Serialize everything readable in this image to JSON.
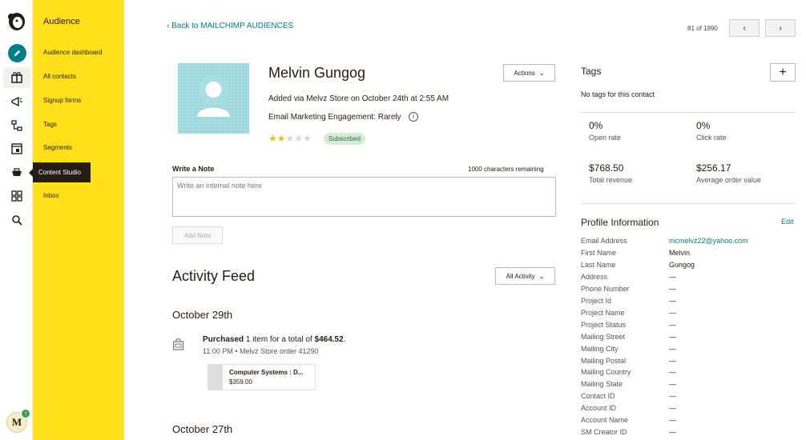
{
  "rail": {
    "avatar_letter": "M",
    "avatar_badge": "↑"
  },
  "submenu": {
    "title": "Audience",
    "items": [
      "Audience dashboard",
      "All contacts",
      "Signup forms",
      "Tags",
      "Segments",
      "Content Studio",
      "Inbox"
    ],
    "tooltip": "Content Studio"
  },
  "header": {
    "back_link": "Back to MAILCHIMP AUDIENCES",
    "pager": "81 of 1990"
  },
  "contact": {
    "name": "Melvin Gungog",
    "added": "Added via Melvz Store on October 24th at 2:55 AM",
    "engagement": "Email Marketing Engagement: Rarely",
    "rating": 2,
    "rating_max": 5,
    "status": "Subscribed",
    "actions_label": "Actions"
  },
  "note": {
    "title": "Write a Note",
    "remaining": "1000 characters remaining",
    "placeholder": "Write an internal note here",
    "button": "Add Note"
  },
  "feed": {
    "title": "Activity Feed",
    "filter": "All Activity",
    "groups": [
      {
        "date": "October 29th",
        "action": "Purchased",
        "text": " 1 item for a total of ",
        "amount": "$464.52",
        "period": ".",
        "meta": "11:00 PM • Melvz Store order 41290",
        "product_name": "Computer Systems : D...",
        "product_price": "$359.00"
      },
      {
        "date": "October 27th"
      }
    ]
  },
  "tags": {
    "title": "Tags",
    "add": "+",
    "empty": "No tags for this contact"
  },
  "stats": [
    {
      "value": "0%",
      "label": "Open rate"
    },
    {
      "value": "0%",
      "label": "Click rate"
    },
    {
      "value": "$768.50",
      "label": "Total revenue"
    },
    {
      "value": "$256.17",
      "label": "Average order value"
    }
  ],
  "profile": {
    "title": "Profile Information",
    "edit": "Edit",
    "fields": [
      {
        "label": "Email Address",
        "value": "mcmelvz22@yahoo.com"
      },
      {
        "label": "First Name",
        "value": "Melvin"
      },
      {
        "label": "Last Name",
        "value": "Gungog"
      },
      {
        "label": "Address",
        "value": "—"
      },
      {
        "label": "Phone Number",
        "value": "—"
      },
      {
        "label": "Project Id",
        "value": "—"
      },
      {
        "label": "Project Name",
        "value": "—"
      },
      {
        "label": "Project Status",
        "value": "—"
      },
      {
        "label": "Mailing Street",
        "value": "—"
      },
      {
        "label": "Mailing City",
        "value": "—"
      },
      {
        "label": "Mailing Postal",
        "value": "—"
      },
      {
        "label": "Mailing Country",
        "value": "—"
      },
      {
        "label": "Mailing State",
        "value": "—"
      },
      {
        "label": "Contact ID",
        "value": "—"
      },
      {
        "label": "Account ID",
        "value": "—"
      },
      {
        "label": "Account Name",
        "value": "—"
      },
      {
        "label": "SM Creator ID",
        "value": "—"
      }
    ]
  },
  "colors": {
    "accent": "#007c89",
    "submenu_bg": "#ffe01b",
    "star_on": "#e8c313"
  }
}
